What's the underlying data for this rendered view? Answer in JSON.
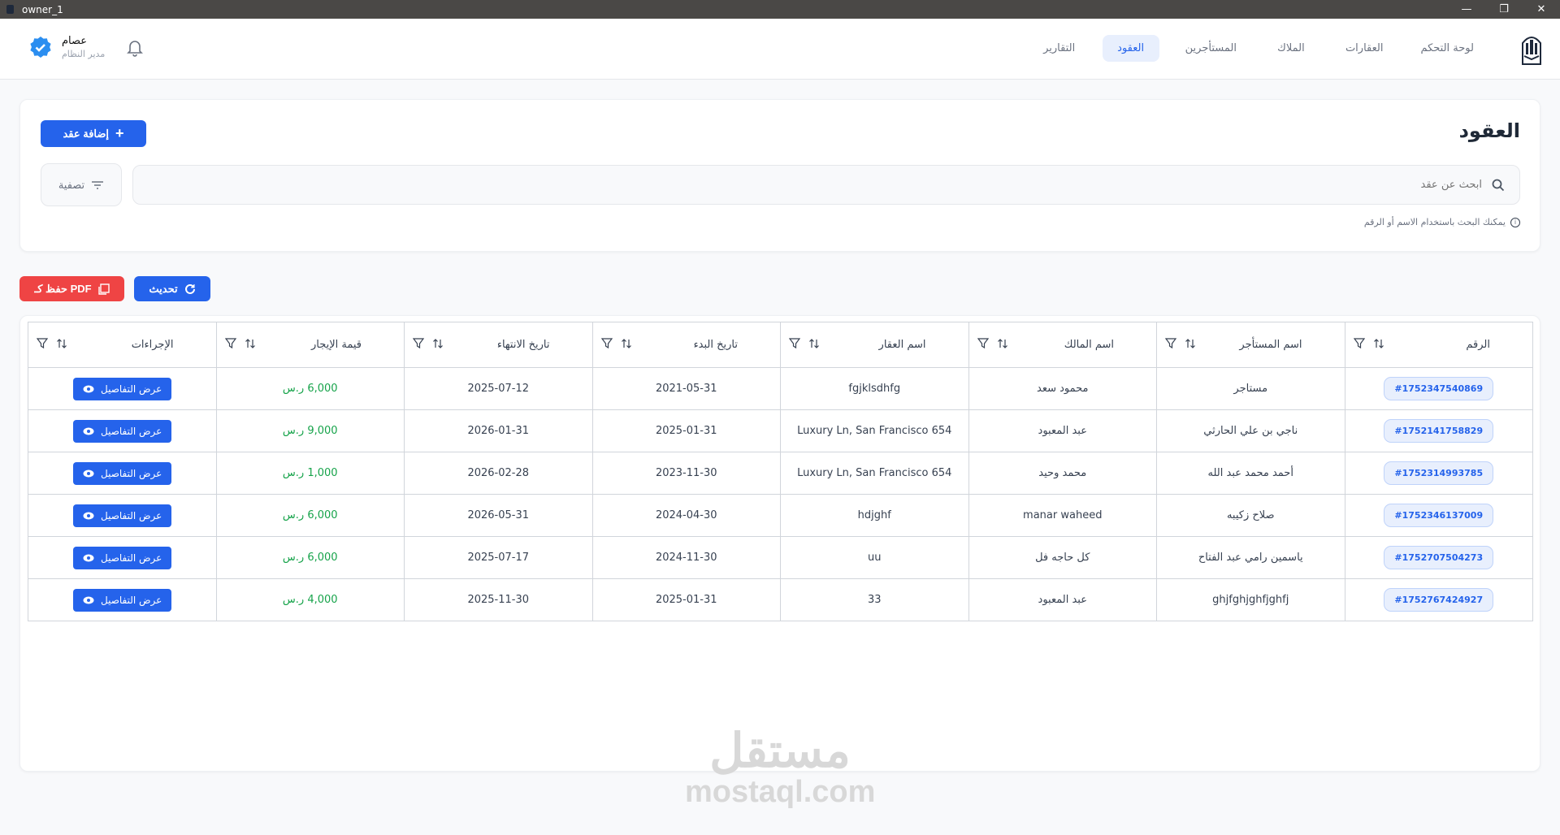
{
  "window": {
    "title": "owner_1"
  },
  "nav": {
    "items": [
      {
        "label": "لوحة التحكم"
      },
      {
        "label": "العقارات"
      },
      {
        "label": "الملاك"
      },
      {
        "label": "المستأجرين"
      },
      {
        "label": "العقود",
        "active": true
      },
      {
        "label": "التقارير"
      }
    ]
  },
  "user": {
    "name": "عصام",
    "role": "مدير النظام"
  },
  "page": {
    "title": "العقود",
    "add_label": "إضافة عقد",
    "filter_label": "تصفية",
    "search_placeholder": "ابحث عن عقد",
    "hint": "يمكنك البحث باستخدام الاسم أو الرقم"
  },
  "toolbar": {
    "pdf_label": "حفظ كـ PDF",
    "refresh_label": "تحديث"
  },
  "table": {
    "columns": [
      "الرقم",
      "اسم المستأجر",
      "اسم المالك",
      "اسم العقار",
      "تاريخ البدء",
      "تاريخ الانتهاء",
      "قيمة الإيجار",
      "الإجراءات"
    ],
    "view_label": "عرض التفاصيل",
    "rows": [
      {
        "id": "#1752347540869",
        "tenant": "مستاجر",
        "owner": "محمود سعد",
        "property": "fgjklsdhfg",
        "start": "2021-05-31",
        "end": "2025-07-12",
        "rent": "6,000 ر.س"
      },
      {
        "id": "#1752141758829",
        "tenant": "ناجي بن علي الحارثي",
        "owner": "عبد المعبود",
        "property": "Luxury Ln, San Francisco 654",
        "start": "2025-01-31",
        "end": "2026-01-31",
        "rent": "9,000 ر.س"
      },
      {
        "id": "#1752314993785",
        "tenant": "أحمد محمد عبد الله",
        "owner": "محمد وحيد",
        "property": "Luxury Ln, San Francisco 654",
        "start": "2023-11-30",
        "end": "2026-02-28",
        "rent": "1,000 ر.س"
      },
      {
        "id": "#1752346137009",
        "tenant": "صلاح زكيبه",
        "owner": "manar waheed",
        "property": "hdjghf",
        "start": "2024-04-30",
        "end": "2026-05-31",
        "rent": "6,000 ر.س"
      },
      {
        "id": "#1752707504273",
        "tenant": "ياسمين رامي عبد الفتاح",
        "owner": "كل حاجه فل",
        "property": "uu",
        "start": "2024-11-30",
        "end": "2025-07-17",
        "rent": "6,000 ر.س"
      },
      {
        "id": "#1752767424927",
        "tenant": "ghjfghjghfjghfj",
        "owner": "عبد المعبود",
        "property": "33",
        "start": "2025-01-31",
        "end": "2025-11-30",
        "rent": "4,000 ر.س"
      }
    ]
  },
  "watermark": {
    "ar": "مستقل",
    "en": "mostaql.com"
  },
  "colors": {
    "primary": "#2563eb",
    "danger": "#ef4444",
    "success": "#16a34a"
  }
}
